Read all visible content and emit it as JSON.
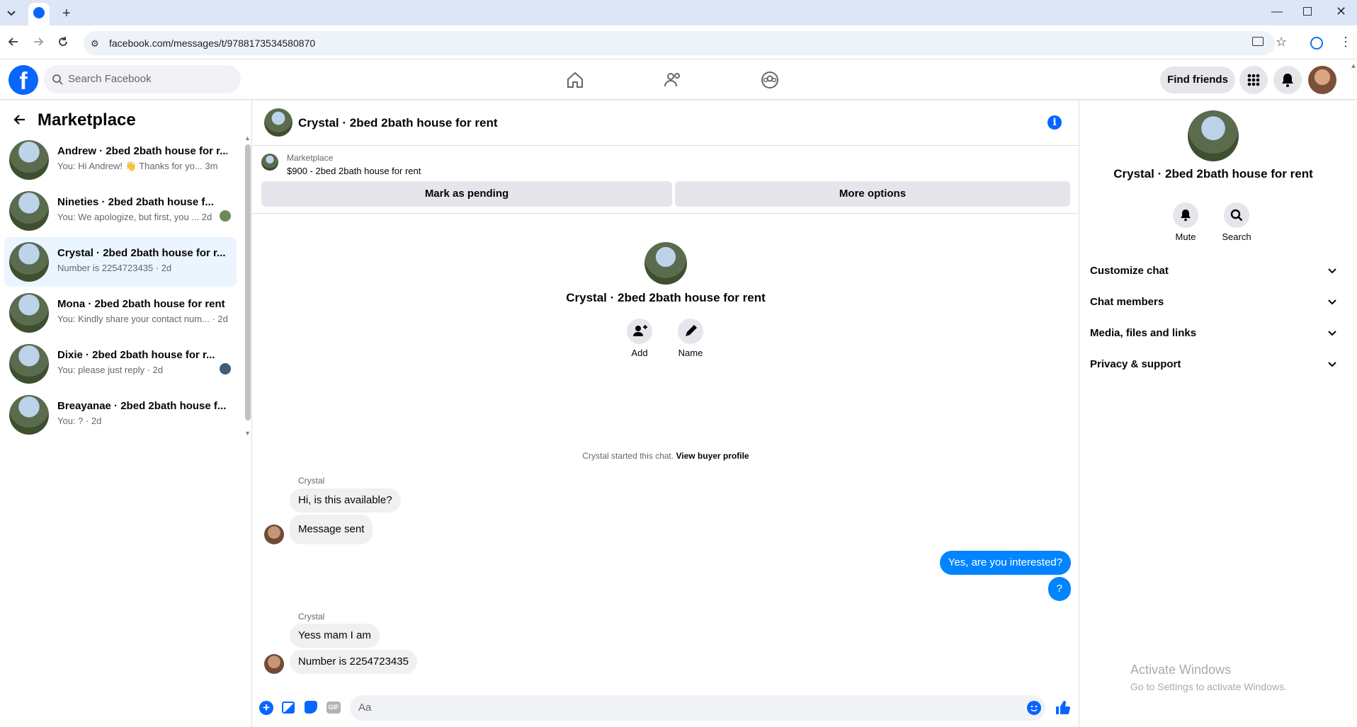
{
  "browser": {
    "url": "facebook.com/messages/t/9788173534580870"
  },
  "header": {
    "search_placeholder": "Search Facebook",
    "find_friends": "Find friends"
  },
  "sidebar": {
    "title": "Marketplace",
    "conversations": [
      {
        "name": "Andrew · 2bed 2bath house for r...",
        "preview": "You: Hi Andrew! 👋 Thanks for yo...  3m",
        "active": false
      },
      {
        "name": "Nineties · 2bed 2bath house f...",
        "preview": "You: We apologize, but first, you ... 2d",
        "active": false
      },
      {
        "name": "Crystal · 2bed 2bath house for r...",
        "preview": "Number is 2254723435 · 2d",
        "active": true
      },
      {
        "name": "Mona · 2bed 2bath house for rent",
        "preview": "You: Kindly share your contact num... · 2d",
        "active": false
      },
      {
        "name": "Dixie · 2bed 2bath house for r...",
        "preview": "You: please just reply · 2d",
        "active": false
      },
      {
        "name": "Breayanae · 2bed 2bath house f...",
        "preview": "You: ? · 2d",
        "active": false
      }
    ]
  },
  "chat": {
    "title": "Crystal · 2bed 2bath house for rent",
    "marketplace_label": "Marketplace",
    "listing": "$900 - 2bed 2bath house for rent",
    "mark_pending": "Mark as pending",
    "more_options": "More options",
    "intro_name": "Crystal · 2bed 2bath house for rent",
    "add_label": "Add",
    "name_label": "Name",
    "started_text": "Crystal started this chat.",
    "view_buyer": "View buyer profile",
    "sender1": "Crystal",
    "msg1": "Hi, is this available?",
    "msg2": "Message sent",
    "out1": "Yes, are you interested?",
    "out2": "?",
    "sender2": "Crystal",
    "msg3": "Yess mam I am",
    "msg4": "Number is 2254723435",
    "composer_placeholder": "Aa"
  },
  "details": {
    "name": "Crystal · 2bed 2bath house for rent",
    "mute": "Mute",
    "search": "Search",
    "sections": [
      "Customize chat",
      "Chat members",
      "Media, files and links",
      "Privacy & support"
    ]
  },
  "watermark": {
    "line1": "Activate Windows",
    "line2": "Go to Settings to activate Windows."
  }
}
